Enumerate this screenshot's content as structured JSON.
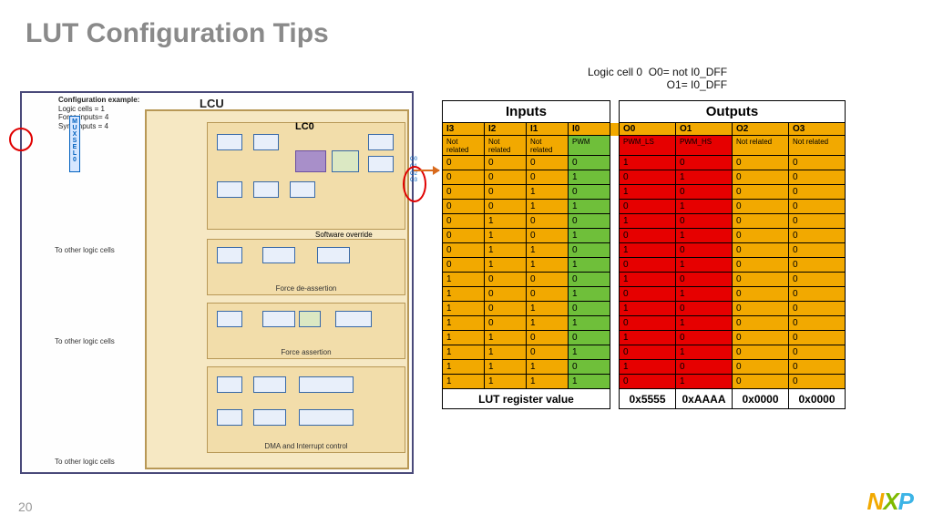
{
  "title": "LUT Configuration Tips",
  "page": "20",
  "logic_caption": "Logic cell 0  O0= not I0_DFF\n                          O1= I0_DFF",
  "cfg_example": {
    "title": "Configuration example:",
    "l1": "Logic cells = 1",
    "l2": "Force inputs= 4",
    "l3": "Sync inputs = 4"
  },
  "diagram": {
    "lcu": "LCU",
    "lc0": "LC0",
    "sw_override": "Software override",
    "force_deassert": "Force de-assertion",
    "force_assert": "Force assertion",
    "dma": "DMA and Interrupt control",
    "to_other1": "To other logic cells",
    "to_other2": "To other logic cells",
    "to_other3": "To other logic cells",
    "muxsel": "MUXSEL0"
  },
  "table": {
    "inputs_label": "Inputs",
    "outputs_label": "Outputs",
    "in_headers": [
      "I3",
      "I2",
      "I1",
      "I0"
    ],
    "out_headers": [
      "O0",
      "O1",
      "O2",
      "O3"
    ],
    "in_sub": [
      "Not related",
      "Not related",
      "Not related",
      "PWM"
    ],
    "out_sub": [
      "PWM_LS",
      "PWM_HS",
      "Not related",
      "Not related"
    ],
    "rows": [
      {
        "i": [
          "0",
          "0",
          "0",
          "0"
        ],
        "o": [
          "1",
          "0",
          "0",
          "0"
        ]
      },
      {
        "i": [
          "0",
          "0",
          "0",
          "1"
        ],
        "o": [
          "0",
          "1",
          "0",
          "0"
        ]
      },
      {
        "i": [
          "0",
          "0",
          "1",
          "0"
        ],
        "o": [
          "1",
          "0",
          "0",
          "0"
        ]
      },
      {
        "i": [
          "0",
          "0",
          "1",
          "1"
        ],
        "o": [
          "0",
          "1",
          "0",
          "0"
        ]
      },
      {
        "i": [
          "0",
          "1",
          "0",
          "0"
        ],
        "o": [
          "1",
          "0",
          "0",
          "0"
        ]
      },
      {
        "i": [
          "0",
          "1",
          "0",
          "1"
        ],
        "o": [
          "0",
          "1",
          "0",
          "0"
        ]
      },
      {
        "i": [
          "0",
          "1",
          "1",
          "0"
        ],
        "o": [
          "1",
          "0",
          "0",
          "0"
        ]
      },
      {
        "i": [
          "0",
          "1",
          "1",
          "1"
        ],
        "o": [
          "0",
          "1",
          "0",
          "0"
        ]
      },
      {
        "i": [
          "1",
          "0",
          "0",
          "0"
        ],
        "o": [
          "1",
          "0",
          "0",
          "0"
        ]
      },
      {
        "i": [
          "1",
          "0",
          "0",
          "1"
        ],
        "o": [
          "0",
          "1",
          "0",
          "0"
        ]
      },
      {
        "i": [
          "1",
          "0",
          "1",
          "0"
        ],
        "o": [
          "1",
          "0",
          "0",
          "0"
        ]
      },
      {
        "i": [
          "1",
          "0",
          "1",
          "1"
        ],
        "o": [
          "0",
          "1",
          "0",
          "0"
        ]
      },
      {
        "i": [
          "1",
          "1",
          "0",
          "0"
        ],
        "o": [
          "1",
          "0",
          "0",
          "0"
        ]
      },
      {
        "i": [
          "1",
          "1",
          "0",
          "1"
        ],
        "o": [
          "0",
          "1",
          "0",
          "0"
        ]
      },
      {
        "i": [
          "1",
          "1",
          "1",
          "0"
        ],
        "o": [
          "1",
          "0",
          "0",
          "0"
        ]
      },
      {
        "i": [
          "1",
          "1",
          "1",
          "1"
        ],
        "o": [
          "0",
          "1",
          "0",
          "0"
        ]
      }
    ],
    "footer_label": "LUT register value",
    "footer_vals": [
      "0x5555",
      "0xAAAA",
      "0x0000",
      "0x0000"
    ]
  },
  "chart_data": {
    "type": "table",
    "title": "Logic cell 0 truth table — O0 = NOT I0_DFF, O1 = I0_DFF",
    "columns": [
      "I3",
      "I2",
      "I1",
      "I0",
      "O0",
      "O1",
      "O2",
      "O3"
    ],
    "rows": [
      [
        0,
        0,
        0,
        0,
        1,
        0,
        0,
        0
      ],
      [
        0,
        0,
        0,
        1,
        0,
        1,
        0,
        0
      ],
      [
        0,
        0,
        1,
        0,
        1,
        0,
        0,
        0
      ],
      [
        0,
        0,
        1,
        1,
        0,
        1,
        0,
        0
      ],
      [
        0,
        1,
        0,
        0,
        1,
        0,
        0,
        0
      ],
      [
        0,
        1,
        0,
        1,
        0,
        1,
        0,
        0
      ],
      [
        0,
        1,
        1,
        0,
        1,
        0,
        0,
        0
      ],
      [
        0,
        1,
        1,
        1,
        0,
        1,
        0,
        0
      ],
      [
        1,
        0,
        0,
        0,
        1,
        0,
        0,
        0
      ],
      [
        1,
        0,
        0,
        1,
        0,
        1,
        0,
        0
      ],
      [
        1,
        0,
        1,
        0,
        1,
        0,
        0,
        0
      ],
      [
        1,
        0,
        1,
        1,
        0,
        1,
        0,
        0
      ],
      [
        1,
        1,
        0,
        0,
        1,
        0,
        0,
        0
      ],
      [
        1,
        1,
        0,
        1,
        0,
        1,
        0,
        0
      ],
      [
        1,
        1,
        1,
        0,
        1,
        0,
        0,
        0
      ],
      [
        1,
        1,
        1,
        1,
        0,
        1,
        0,
        0
      ]
    ],
    "lut_register_values": {
      "O0": "0x5555",
      "O1": "0xAAAA",
      "O2": "0x0000",
      "O3": "0x0000"
    }
  }
}
